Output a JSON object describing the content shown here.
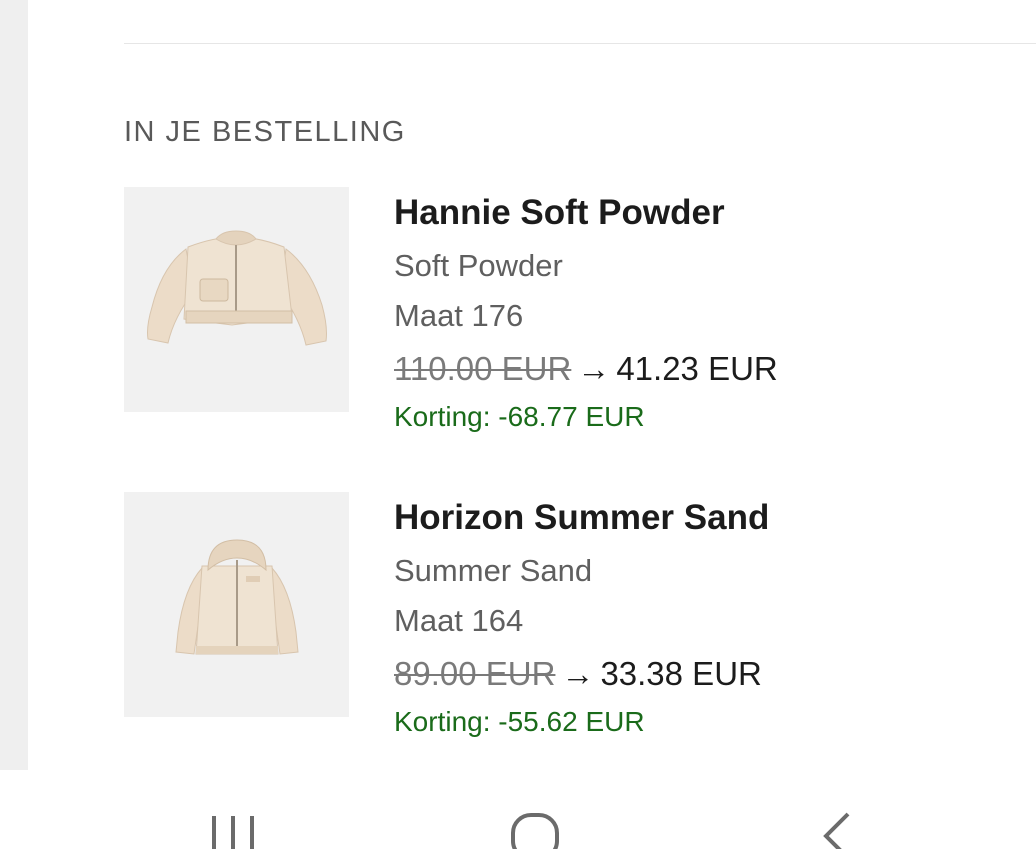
{
  "section": {
    "title": "IN JE BESTELLING"
  },
  "items": [
    {
      "name": "Hannie Soft Powder",
      "variant": "Soft Powder",
      "size": "Maat 176",
      "old_price": "110.00 EUR",
      "arrow": "→",
      "new_price": "41.23 EUR",
      "discount": "Korting: -68.77 EUR",
      "image_icon": "cropped-bomber-jacket-image"
    },
    {
      "name": "Horizon Summer Sand",
      "variant": "Summer Sand",
      "size": "Maat 164",
      "old_price": "89.00 EUR",
      "arrow": "→",
      "new_price": "33.38 EUR",
      "discount": "Korting: -55.62 EUR",
      "image_icon": "hooded-jacket-image"
    }
  ],
  "nav": {
    "recent_icon": "recent-apps-icon",
    "home_icon": "home-icon",
    "back_icon": "back-icon"
  },
  "colors": {
    "discount": "#1a6b1a",
    "text": "#1c1c1c",
    "muted": "#5f5f5f",
    "thumb_bg": "#f1f1f1",
    "garment": "#efe3d2"
  }
}
